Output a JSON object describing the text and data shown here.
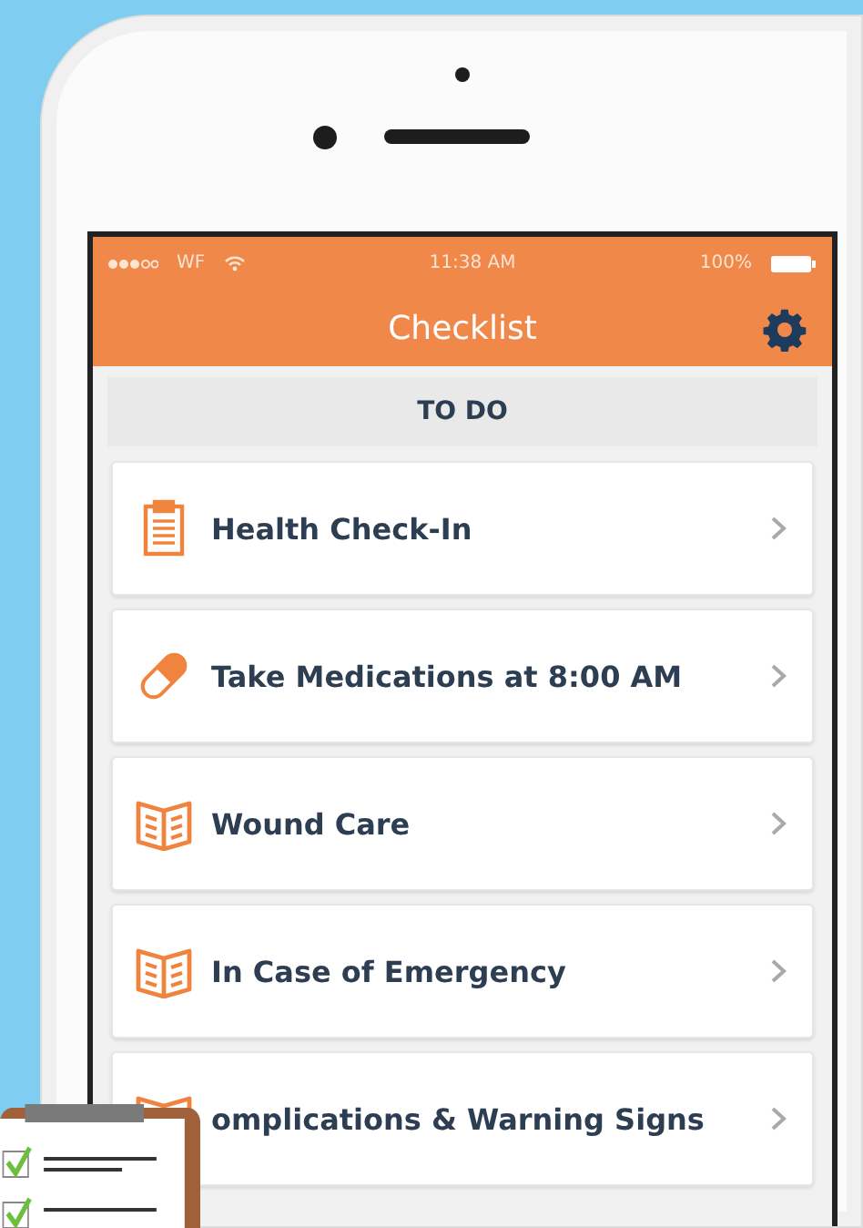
{
  "status_bar": {
    "carrier": "WF",
    "time": "11:38 AM",
    "battery": "100%"
  },
  "nav": {
    "title": "Checklist"
  },
  "section": {
    "title": "TO DO"
  },
  "items": [
    {
      "kind": "form",
      "label": "Health Check-In"
    },
    {
      "kind": "medication",
      "label": "Take Medications at 8:00 AM"
    },
    {
      "kind": "guide",
      "label": "Wound Care"
    },
    {
      "kind": "guide",
      "label": "In Case of Emergency"
    },
    {
      "kind": "guide",
      "label": "omplications & Warning Signs"
    }
  ]
}
